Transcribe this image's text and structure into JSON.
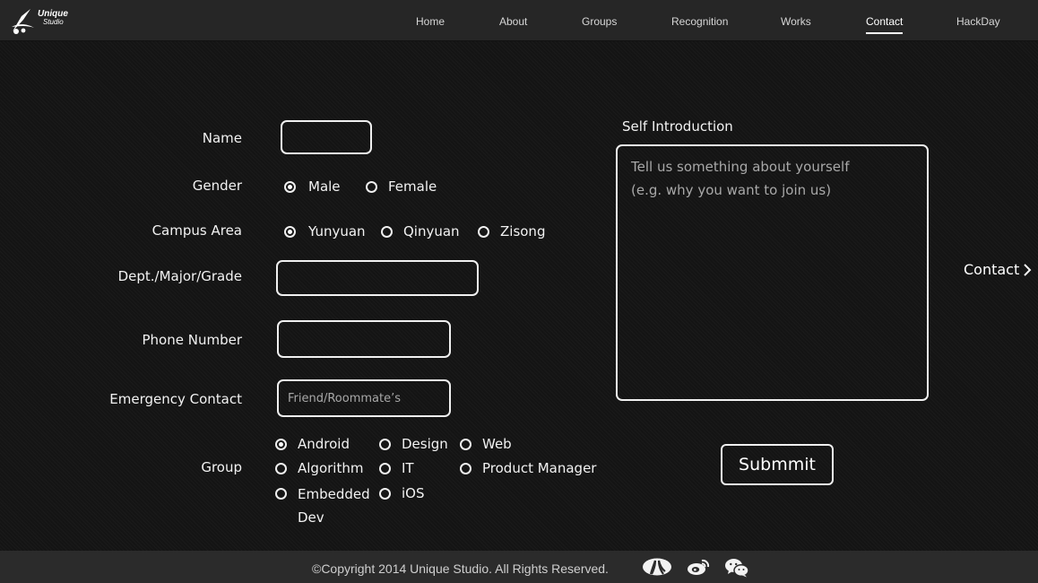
{
  "brand": {
    "line1": "Unique",
    "line2": "Studio"
  },
  "nav": {
    "items": [
      {
        "label": "Home"
      },
      {
        "label": "About"
      },
      {
        "label": "Groups"
      },
      {
        "label": "Recognition"
      },
      {
        "label": "Works"
      },
      {
        "label": "Contact",
        "active": true
      },
      {
        "label": "HackDay"
      }
    ]
  },
  "form": {
    "name_label": "Name",
    "name_value": "",
    "gender_label": "Gender",
    "gender_options": [
      {
        "label": "Male",
        "selected": true
      },
      {
        "label": "Female",
        "selected": false
      }
    ],
    "campus_label": "Campus Area",
    "campus_options": [
      {
        "label": "Yunyuan",
        "selected": true
      },
      {
        "label": "Qinyuan",
        "selected": false
      },
      {
        "label": "Zisong",
        "selected": false
      }
    ],
    "dept_label": "Dept./Major/Grade",
    "dept_value": "",
    "phone_label": "Phone Number",
    "phone_value": "",
    "emergency_label": "Emergency Contact",
    "emergency_placeholder": "Friend/Roommate’s",
    "group_label": "Group",
    "group_options": [
      {
        "label": "Android",
        "selected": true
      },
      {
        "label": "Design",
        "selected": false
      },
      {
        "label": "Web",
        "selected": false
      },
      {
        "label": "Algorithm",
        "selected": false
      },
      {
        "label": "IT",
        "selected": false
      },
      {
        "label": "Product Manager",
        "selected": false
      },
      {
        "label": "Embedded Dev",
        "selected": false
      },
      {
        "label": "iOS",
        "selected": false
      }
    ],
    "intro_label": "Self Introduction",
    "intro_placeholder": "Tell us something about yourself\n(e.g. why you want to join us)",
    "submit_label": "Submmit"
  },
  "side_link": {
    "label": "Contact",
    "icon": "chevron-right-icon"
  },
  "footer": {
    "copyright": "©Copyright 2014 Unique Studio. All Rights Reserved.",
    "icons": [
      "renren-icon",
      "weibo-icon",
      "wechat-icon"
    ]
  },
  "colors": {
    "background": "#141414",
    "topbar": "#262626",
    "footer": "#2b2b2b",
    "foreground": "#ffffff"
  }
}
